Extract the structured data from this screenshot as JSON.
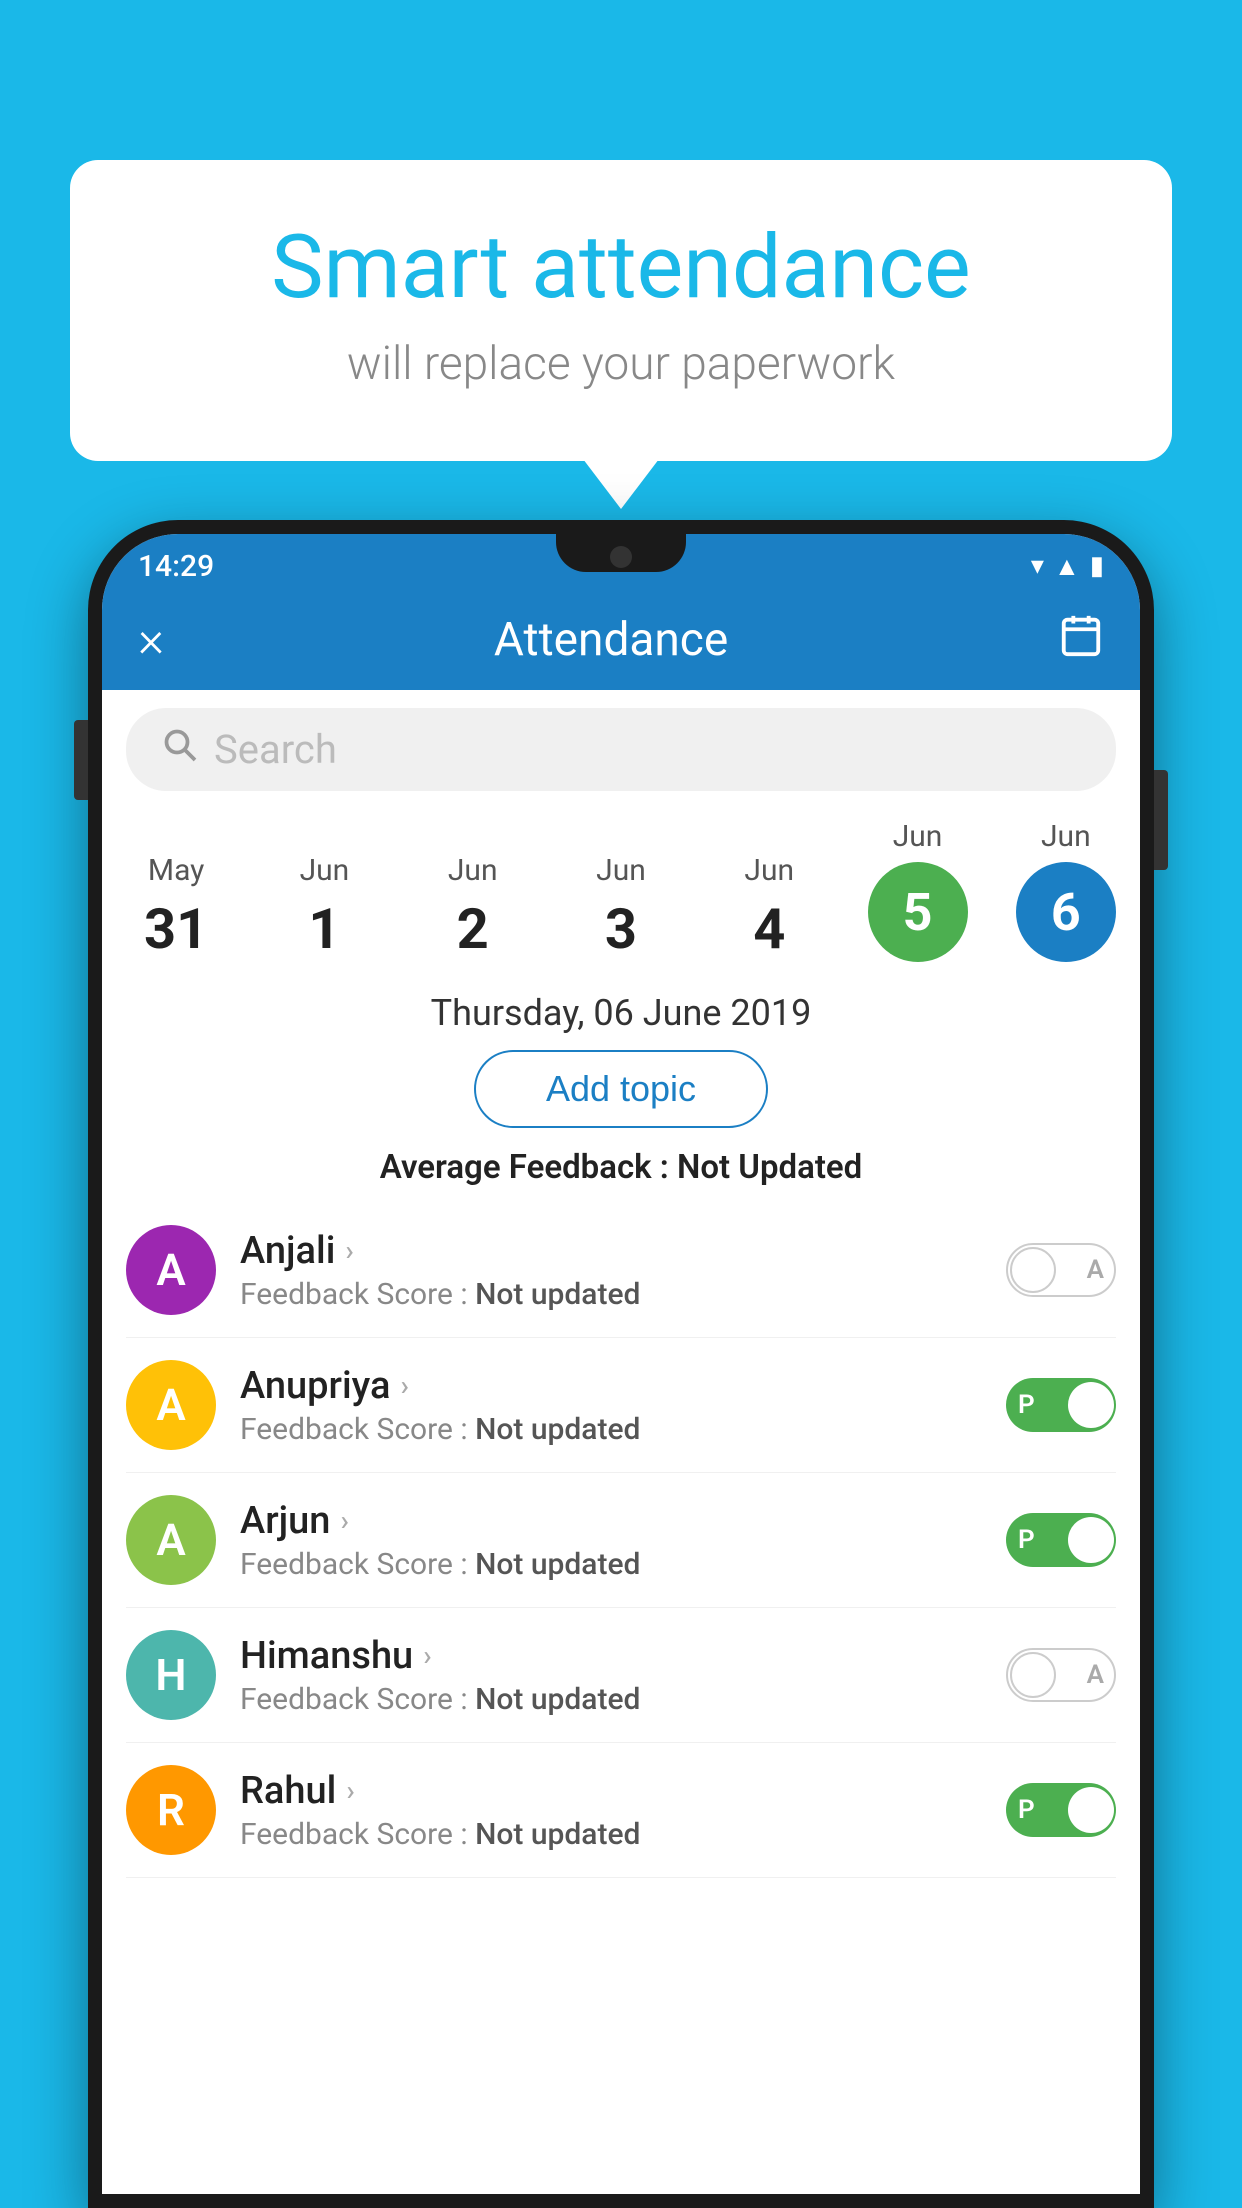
{
  "background_color": "#1ab8e8",
  "speech_bubble": {
    "title": "Smart attendance",
    "subtitle": "will replace your paperwork"
  },
  "status_bar": {
    "time": "14:29",
    "icons": [
      "wifi",
      "signal",
      "battery"
    ]
  },
  "app_bar": {
    "close_label": "×",
    "title": "Attendance",
    "calendar_icon": "📅"
  },
  "search": {
    "placeholder": "Search"
  },
  "date_picker": {
    "dates": [
      {
        "month": "May",
        "day": "31",
        "state": "normal"
      },
      {
        "month": "Jun",
        "day": "1",
        "state": "normal"
      },
      {
        "month": "Jun",
        "day": "2",
        "state": "normal"
      },
      {
        "month": "Jun",
        "day": "3",
        "state": "normal"
      },
      {
        "month": "Jun",
        "day": "4",
        "state": "normal"
      },
      {
        "month": "Jun",
        "day": "5",
        "state": "today"
      },
      {
        "month": "Jun",
        "day": "6",
        "state": "selected"
      }
    ]
  },
  "selected_date_label": "Thursday, 06 June 2019",
  "add_topic_label": "Add topic",
  "avg_feedback_label": "Average Feedback :",
  "avg_feedback_value": "Not Updated",
  "students": [
    {
      "name": "Anjali",
      "initial": "A",
      "avatar_color": "purple",
      "feedback_label": "Feedback Score :",
      "feedback_value": "Not updated",
      "attendance": "absent"
    },
    {
      "name": "Anupriya",
      "initial": "A",
      "avatar_color": "yellow",
      "feedback_label": "Feedback Score :",
      "feedback_value": "Not updated",
      "attendance": "present"
    },
    {
      "name": "Arjun",
      "initial": "A",
      "avatar_color": "green",
      "feedback_label": "Feedback Score :",
      "feedback_value": "Not updated",
      "attendance": "present"
    },
    {
      "name": "Himanshu",
      "initial": "H",
      "avatar_color": "teal",
      "feedback_label": "Feedback Score :",
      "feedback_value": "Not updated",
      "attendance": "absent"
    },
    {
      "name": "Rahul",
      "initial": "R",
      "avatar_color": "orange",
      "feedback_label": "Feedback Score :",
      "feedback_value": "Not updated",
      "attendance": "present"
    }
  ]
}
